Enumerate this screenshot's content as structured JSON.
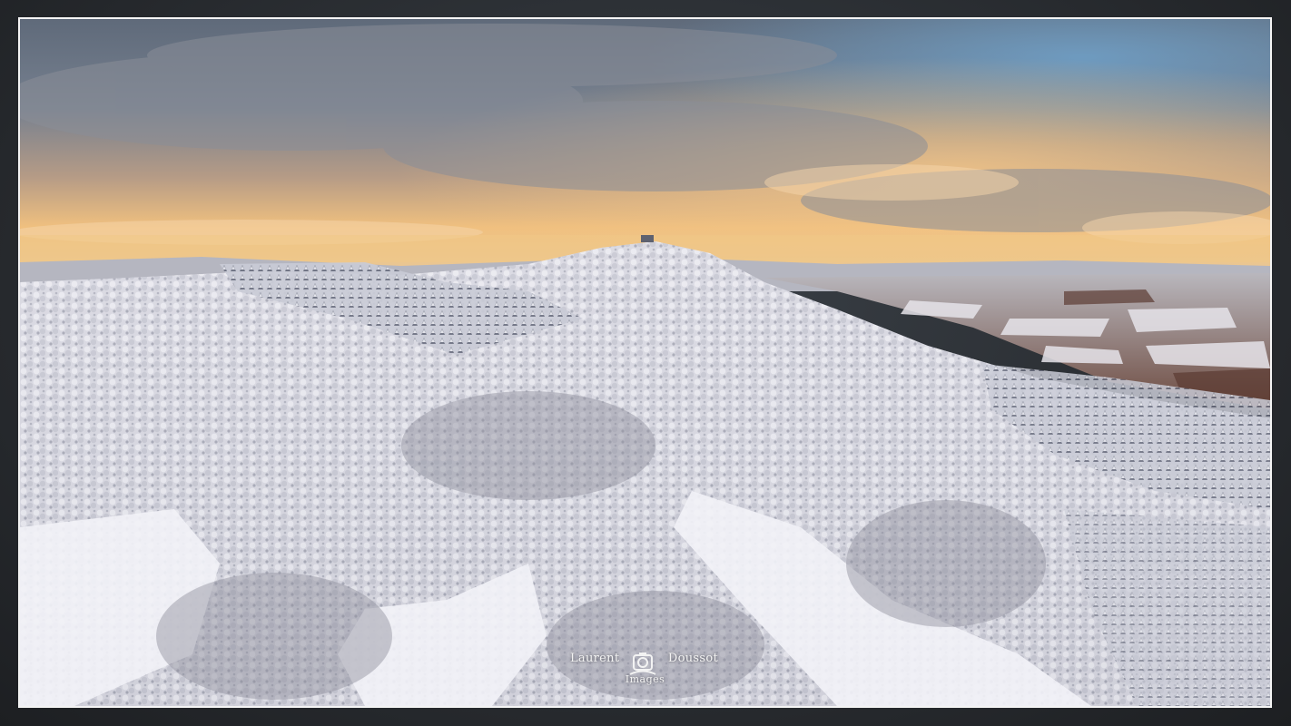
{
  "watermark": {
    "first_name": "Laurent",
    "last_name": "Doussot",
    "sub": "Images"
  },
  "scene": {
    "subject": "snow-covered-forested-hill",
    "sky": "cloudy-sunset",
    "colors": {
      "sky_top": "#5d6b7e",
      "sky_glow": "#f2c07a",
      "snow": "#e9e9ef",
      "forest_shadow": "#7c7f8c",
      "frame_border": "#f4f4f4",
      "frame_bg": "#26292d"
    }
  }
}
